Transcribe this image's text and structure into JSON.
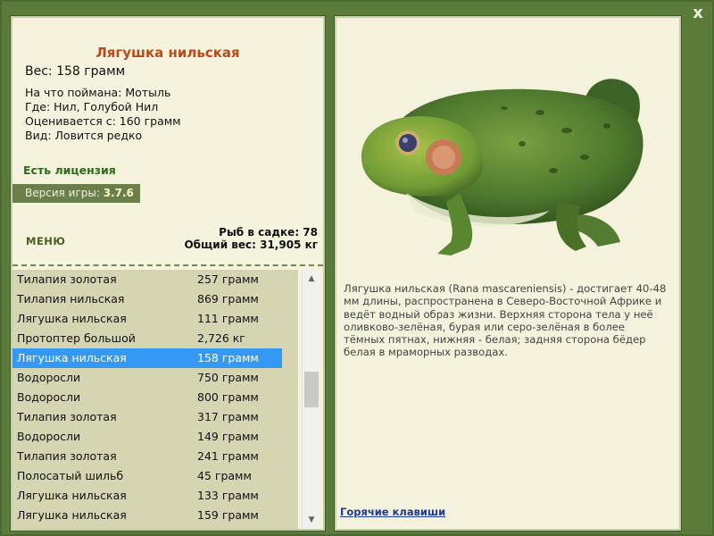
{
  "window": {
    "close_label": "x"
  },
  "fish": {
    "title": "Лягушка нильская",
    "weight": "Вес: 158 грамм",
    "caught_on": "На что поймана: Мотыль",
    "location": "Где: Нил, Голубой Нил",
    "valued_from": "Оценивается с: 160 грамм",
    "rarity": "Вид: Ловится редко"
  },
  "license": "Есть лицензия",
  "version": {
    "label": "Версия игры: ",
    "value": "3.7.6"
  },
  "menu_label": "МЕНЮ",
  "stats": {
    "fish_count": "Рыб в садке: 78",
    "total_weight": "Общий вес: 31,905 кг"
  },
  "catch_list": [
    {
      "name": "Тилапия золотая",
      "weight": "257 грамм"
    },
    {
      "name": "Тилапия нильская",
      "weight": "869 грамм"
    },
    {
      "name": "Лягушка нильская",
      "weight": "111 грамм"
    },
    {
      "name": "Протоптер большой",
      "weight": "2,726 кг"
    },
    {
      "name": "Лягушка нильская",
      "weight": "158 грамм",
      "selected": true
    },
    {
      "name": "Водоросли",
      "weight": "750 грамм"
    },
    {
      "name": "Водоросли",
      "weight": "800 грамм"
    },
    {
      "name": "Тилапия золотая",
      "weight": "317 грамм"
    },
    {
      "name": "Водоросли",
      "weight": "149 грамм"
    },
    {
      "name": "Тилапия золотая",
      "weight": "241 грамм"
    },
    {
      "name": "Полосатый шильб",
      "weight": "45 грамм"
    },
    {
      "name": "Лягушка нильская",
      "weight": "133 грамм"
    },
    {
      "name": "Лягушка нильская",
      "weight": "159 грамм"
    }
  ],
  "description": "Лягушка нильская (Rana mascareniensis) - достигает 40-48 мм длины, распространена в Северо-Восточной Африке и ведёт водный образ жизни. Верхняя сторона тела у неё оливково-зелёная, бурая или серо-зелёная в более тёмных пятнах, нижняя - белая; задняя сторона бёдер белая в мраморных разводах.",
  "hotkeys_label": "Горячие клавиши",
  "colors": {
    "frame": "#5b7b3b",
    "panel_bg": "#f4f1dc",
    "list_bg": "#d6d5b1",
    "selection": "#3399f4",
    "title": "#b94a1a",
    "license": "#2f6b1c",
    "link": "#1b3b9c"
  }
}
